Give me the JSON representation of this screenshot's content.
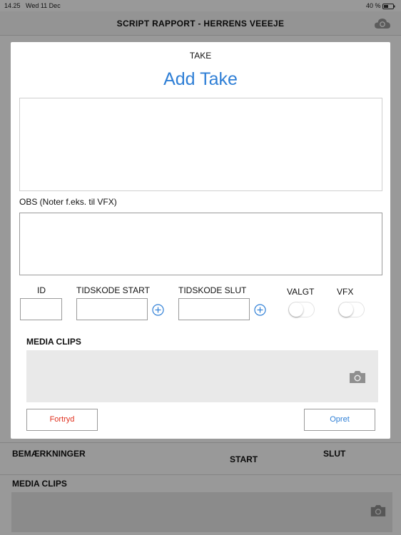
{
  "statusbar": {
    "time": "14.25",
    "date": "Wed 11 Dec",
    "battery": "40 %"
  },
  "app": {
    "title": "SCRIPT RAPPORT - HERRENS VEEEJE",
    "cloud_icon": "cloud-sync-icon",
    "background": {
      "remarks_label": "BEMÆRKNINGER",
      "start_label": "START",
      "end_label": "SLUT",
      "media_clips_label": "MEDIA CLIPS",
      "camera_icon": "camera-icon"
    }
  },
  "modal": {
    "eyebrow": "TAKE",
    "title": "Add Take",
    "obs_label": "OBS (Noter f.eks. til VFX)",
    "fields": {
      "id_label": "ID",
      "tc_start_label": "TIDSKODE START",
      "tc_end_label": "TIDSKODE SLUT",
      "selected_label": "VALGT",
      "vfx_label": "VFX",
      "selected_on": false,
      "vfx_on": false
    },
    "media_clips_label": "MEDIA CLIPS",
    "cancel_label": "Fortryd",
    "create_label": "Opret",
    "colors": {
      "accent": "#2f7fd6",
      "cancel": "#e0301e"
    }
  }
}
